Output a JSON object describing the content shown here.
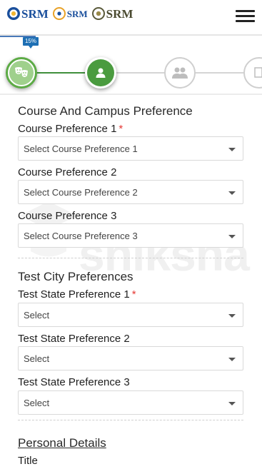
{
  "header": {
    "logos": [
      {
        "text": "SRM"
      },
      {
        "text": "SRM"
      },
      {
        "text": "SRM"
      }
    ]
  },
  "progress": {
    "percent_label": "15%",
    "percent": 15,
    "current_step": 2,
    "total_steps_visible": 4
  },
  "watermark": {
    "text": "shiksha"
  },
  "form": {
    "course_section": {
      "title": "Course And Campus Preference",
      "fields": [
        {
          "label": "Course Preference 1",
          "required": true,
          "value": "Select Course Preference 1"
        },
        {
          "label": "Course Preference 2",
          "required": false,
          "value": "Select Course Preference 2"
        },
        {
          "label": "Course Preference 3",
          "required": false,
          "value": "Select Course Preference 3"
        }
      ]
    },
    "test_city_section": {
      "title": "Test City Preferences",
      "fields": [
        {
          "label": "Test State Preference 1",
          "required": true,
          "value": "Select"
        },
        {
          "label": "Test State Preference 2",
          "required": false,
          "value": "Select"
        },
        {
          "label": "Test State Preference 3",
          "required": false,
          "value": "Select"
        }
      ]
    },
    "personal_section": {
      "title": "Personal Details",
      "first_field_label": "Title"
    }
  },
  "colors": {
    "step_done": "#5cab45",
    "step_current": "#4a9b3f",
    "badge": "#1d6fb4",
    "required": "#e53935"
  }
}
